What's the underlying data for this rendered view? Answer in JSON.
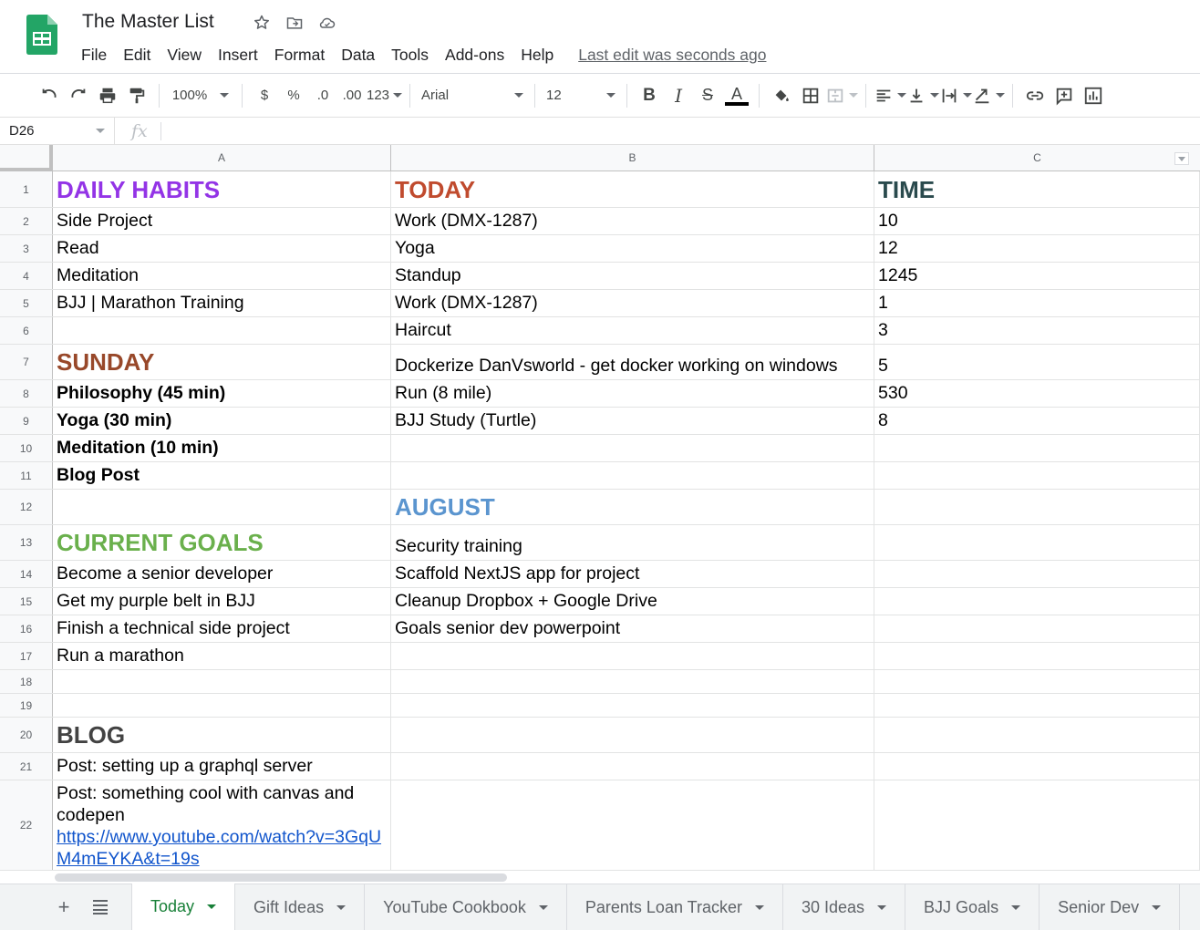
{
  "app": {
    "title": "The Master List",
    "last_edit": "Last edit was seconds ago",
    "menu": [
      "File",
      "Edit",
      "View",
      "Insert",
      "Format",
      "Data",
      "Tools",
      "Add-ons",
      "Help"
    ]
  },
  "toolbar": {
    "zoom": "100%",
    "currency": "$",
    "percent": "%",
    "decrease_decimal": ".0",
    "increase_decimal": ".00",
    "more_formats": "123",
    "font": "Arial",
    "font_size": "12",
    "text_color": "#000000"
  },
  "formula_bar": {
    "cell_ref": "D26",
    "fx": "fx",
    "value": ""
  },
  "columns": [
    "A",
    "B",
    "C"
  ],
  "rows": [
    {
      "n": "1",
      "a": "DAILY HABITS",
      "b": "TODAY",
      "c": "TIME"
    },
    {
      "n": "2",
      "a": "Side Project",
      "b": "Work (DMX-1287)",
      "c": "10"
    },
    {
      "n": "3",
      "a": "Read",
      "b": "Yoga",
      "c": "12"
    },
    {
      "n": "4",
      "a": "Meditation",
      "b": "Standup",
      "c": "1245"
    },
    {
      "n": "5",
      "a": "BJJ | Marathon Training",
      "b": "Work (DMX-1287)",
      "c": "1"
    },
    {
      "n": "6",
      "a": "",
      "b": "Haircut",
      "c": "3"
    },
    {
      "n": "7",
      "a": "SUNDAY",
      "b": "Dockerize DanVsworld - get docker working on windows",
      "c": "5"
    },
    {
      "n": "8",
      "a": "Philosophy (45 min)",
      "b": "Run (8 mile)",
      "c": "530"
    },
    {
      "n": "9",
      "a": "Yoga (30 min)",
      "b": "BJJ Study (Turtle)",
      "c": "8"
    },
    {
      "n": "10",
      "a": "Meditation (10 min)",
      "b": "",
      "c": ""
    },
    {
      "n": "11",
      "a": "Blog Post",
      "b": "",
      "c": ""
    },
    {
      "n": "12",
      "a": "",
      "b": "AUGUST",
      "c": ""
    },
    {
      "n": "13",
      "a": "CURRENT GOALS",
      "b": "Security training",
      "c": ""
    },
    {
      "n": "14",
      "a": "Become a senior developer",
      "b": "Scaffold NextJS app for project",
      "c": ""
    },
    {
      "n": "15",
      "a": "Get my purple belt in BJJ",
      "b": "Cleanup Dropbox + Google Drive",
      "c": ""
    },
    {
      "n": "16",
      "a": "Finish a technical side project",
      "b": "Goals senior dev powerpoint",
      "c": ""
    },
    {
      "n": "17",
      "a": "Run a marathon",
      "b": "",
      "c": ""
    },
    {
      "n": "18",
      "a": "",
      "b": "",
      "c": ""
    },
    {
      "n": "19",
      "a": "",
      "b": "",
      "c": ""
    },
    {
      "n": "20",
      "a": "BLOG",
      "b": "",
      "c": ""
    },
    {
      "n": "21",
      "a": "Post: setting up a graphql server",
      "b": "",
      "c": ""
    },
    {
      "n": "22",
      "a": "Post: something cool with canvas and codepen",
      "a_link": "https://www.youtube.com/watch?v=3GqUM4mEYKA&t=19s",
      "b": "",
      "c": ""
    }
  ],
  "sheets": [
    "Today",
    "Gift Ideas",
    "YouTube Cookbook",
    "Parents Loan Tracker",
    "30 Ideas",
    "BJJ Goals",
    "Senior Dev"
  ],
  "active_sheet": "Today",
  "colors": {
    "daily_habits": "#9334e6",
    "today": "#c04b2e",
    "time": "#2a4a4d",
    "sunday": "#98482a",
    "august": "#5b95cf",
    "current_goals": "#6ab04c",
    "blog": "#434343",
    "sheets_green": "#188038"
  }
}
